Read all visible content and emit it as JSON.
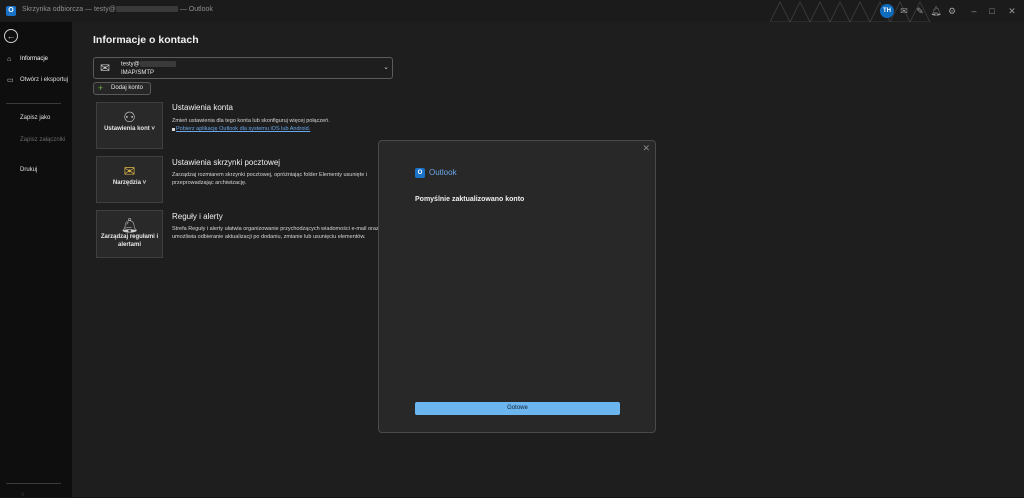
{
  "titlebar": {
    "app_icon": "O",
    "title_prefix": "Skrzynka odbiorcza — testy@",
    "title_suffix": " — Outlook",
    "avatar_initials": "TH",
    "icons": [
      "mail-icon",
      "pen-icon",
      "bell-icon",
      "settings-icon",
      "minimize-icon",
      "maximize-icon",
      "close-icon"
    ]
  },
  "sidebar": {
    "items": [
      {
        "label": "Informacje",
        "icon": "info-icon"
      },
      {
        "label": "Otwórz i eksportuj",
        "icon": "folder-icon"
      },
      {
        "label": "Zapisz jako",
        "icon": ""
      },
      {
        "label": "Zapisz załączniki",
        "icon": ""
      },
      {
        "label": "Drukuj",
        "icon": ""
      }
    ]
  },
  "main": {
    "title": "Informacje o kontach",
    "account": {
      "email": "testy@",
      "type": "IMAP/SMTP"
    },
    "add_account_label": "Dodaj konto",
    "sections": [
      {
        "button_label": "Ustawienia kont ˅",
        "title": "Ustawienia konta",
        "description": "Zmień ustawienia dla tego konta lub skonfiguruj więcej połączeń.",
        "link": "Pobierz aplikację Outlook dla systemu iOS lub Android."
      },
      {
        "button_label": "Narzędzia ˅",
        "title": "Ustawienia skrzynki pocztowej",
        "description": "Zarządzaj rozmiarem skrzynki pocztowej, opróżniając folder Elementy usunięte i przeprowadzając archiwizację."
      },
      {
        "button_label": "Zarządzaj regułami i alertami",
        "title": "Reguły i alerty",
        "description": "Strefa Reguły i alerty ułatwia organizowanie przychodzących wiadomości e-mail oraz umożliwia odbieranie aktualizacji po dodaniu, zmianie lub usunięciu elementów."
      }
    ]
  },
  "dialog": {
    "app_name": "Outlook",
    "message": "Pomyślnie zaktualizowano konto",
    "ok_label": "Gotowe"
  }
}
